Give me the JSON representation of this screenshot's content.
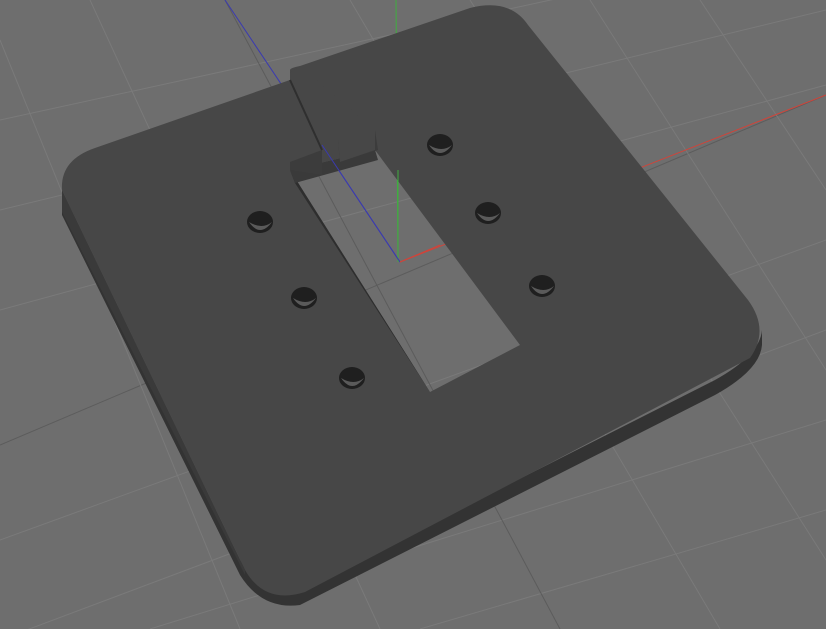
{
  "viewport": {
    "background_color": "#6e6e6e",
    "grid_minor_color": "#767676",
    "grid_major_color": "#5f5f5f"
  },
  "axes": {
    "x_axis_color": "#d0443a",
    "y_axis_color": "#3fae3f",
    "z_axis_color": "#3a3ab0"
  },
  "model": {
    "top_face_color": "#474747",
    "edge_face_color": "#3a3a3a",
    "bottom_face_color": "#2f2f2f",
    "hole_color": "#1e1e1e",
    "hole_count": 6,
    "slot_open_color": "#6e6e6e",
    "slot_wall_color": "#2c2c2c"
  }
}
